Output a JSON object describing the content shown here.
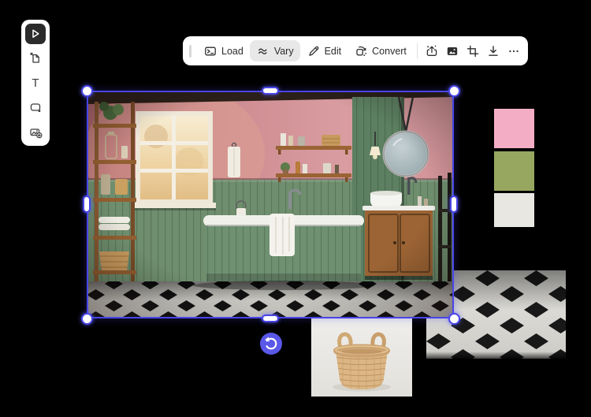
{
  "window": {
    "background": "#000000"
  },
  "sidebar": {
    "tools": [
      {
        "id": "select",
        "icon": "cursor-icon",
        "active": true
      },
      {
        "id": "import-document",
        "icon": "document-import-icon",
        "active": false
      },
      {
        "id": "text",
        "icon": "text-icon",
        "glyph": "T",
        "active": false
      },
      {
        "id": "shape",
        "icon": "shape-icon",
        "active": false
      },
      {
        "id": "add-media",
        "icon": "add-image-icon",
        "active": false
      }
    ]
  },
  "toolbar": {
    "load_label": "Load",
    "vary_label": "Vary",
    "edit_label": "Edit",
    "convert_label": "Convert",
    "icon_buttons": [
      "generative-upload-icon",
      "image-icon",
      "crop-icon",
      "download-icon",
      "more-icon"
    ]
  },
  "selection": {
    "border_color": "#4845e8"
  },
  "swatches": [
    {
      "name": "pink",
      "color": "#f3aec5"
    },
    {
      "name": "olive-green",
      "color": "#97a75f"
    },
    {
      "name": "off-white",
      "color": "#e9e7e2"
    }
  ],
  "undo_button": {
    "color": "#5a58e8"
  },
  "canvas_objects": [
    "bathroom-photo",
    "checkered-floor-photo",
    "wicker-basket-photo"
  ]
}
